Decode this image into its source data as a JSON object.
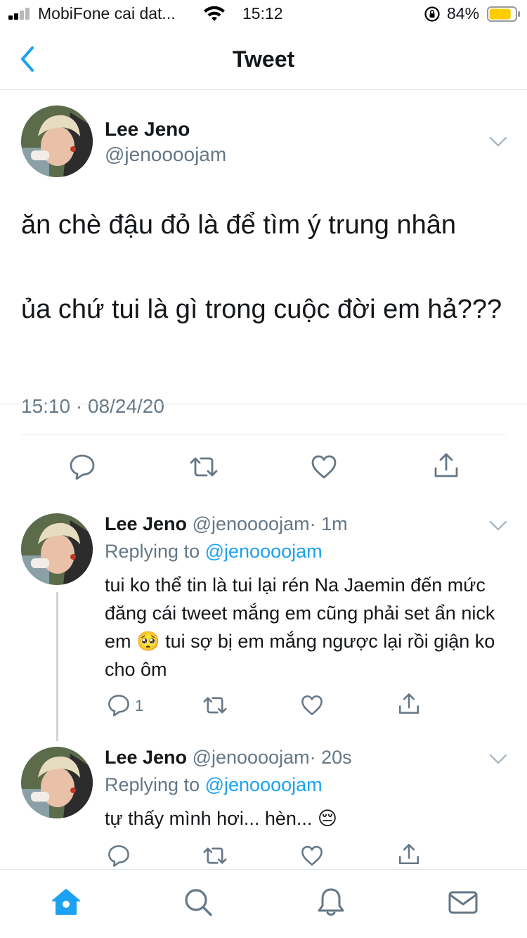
{
  "status_bar": {
    "carrier": "MobiFone cai dat...",
    "time": "15:12",
    "battery_percent": "84%",
    "battery_level": 0.84,
    "signal_bars": 2,
    "battery_color": "#ffcc00"
  },
  "nav": {
    "title": "Tweet",
    "back_icon": "chevron-left-icon",
    "accent": "#1da1f2"
  },
  "main_tweet": {
    "name": "Lee Jeno",
    "handle": "@jenoooojam",
    "text": "ăn chè đậu đỏ là để tìm ý trung nhân\n\nủa chứ tui là gì trong cuộc đời em hả???",
    "timestamp": "15:10 · 08/24/20",
    "actions": [
      "reply-icon",
      "retweet-icon",
      "like-icon",
      "share-icon"
    ]
  },
  "replies": [
    {
      "name": "Lee Jeno",
      "handle": "@jenoooojam",
      "time": "· 1m",
      "replying_prefix": "Replying to",
      "replying_to": "@jenoooojam",
      "text": "tui ko thể tin là tui lại rén Na Jaemin đến mức đăng cái tweet mắng em cũng phải set ẩn nick em 🥺 tui sợ bị em mắng ngược lại rồi giận ko cho ôm",
      "reply_count": "1"
    },
    {
      "name": "Lee Jeno",
      "handle": "@jenoooojam",
      "time": "· 20s",
      "replying_prefix": "Replying to",
      "replying_to": "@jenoooojam",
      "text": "tự thấy mình hơi... hèn... 😔",
      "reply_count": ""
    }
  ],
  "tab_bar": {
    "items": [
      "home-icon",
      "search-icon",
      "notifications-icon",
      "messages-icon"
    ],
    "active": "home-icon"
  }
}
